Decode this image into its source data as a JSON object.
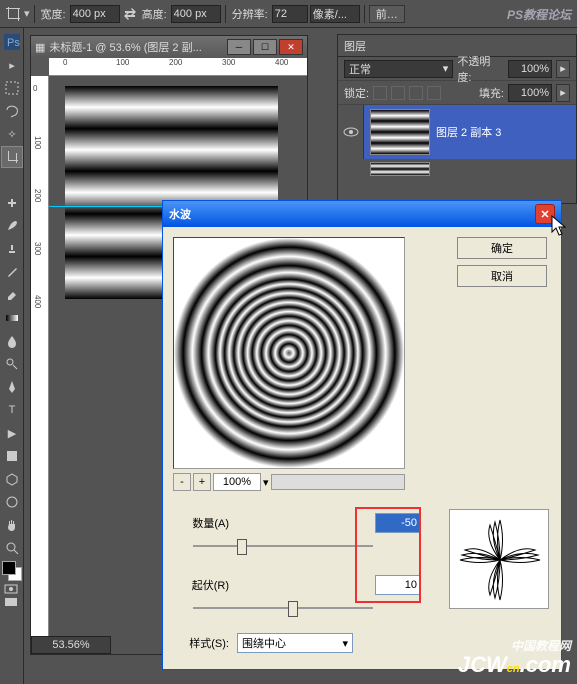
{
  "options": {
    "width_label": "宽度:",
    "width_value": "400 px",
    "height_label": "高度:",
    "height_value": "400 px",
    "res_label": "分辨率:",
    "res_value": "72",
    "units": "像素/...",
    "front_btn": "前…"
  },
  "document": {
    "title": "未标题-1 @ 53.6% (图层 2 副...",
    "zoom": "53.56%",
    "ruler_top": [
      "0",
      "100",
      "200",
      "300",
      "400"
    ],
    "ruler_left": [
      "0",
      "100",
      "200",
      "300",
      "400"
    ]
  },
  "layers": {
    "tab": "图层",
    "blend": "正常",
    "opacity_label": "不透明度:",
    "opacity": "100%",
    "lock_label": "锁定:",
    "fill_label": "填充:",
    "fill": "100%",
    "layer_name": "图层 2 副本 3"
  },
  "dialog": {
    "title": "水波",
    "ok": "确定",
    "cancel": "取消",
    "zoom": "100%",
    "amount_label": "数量(A)",
    "amount_value": "-50",
    "ridges_label": "起伏(R)",
    "ridges_value": "10",
    "style_label": "样式(S):",
    "style_value": "围绕中心"
  },
  "watermark": {
    "top": "PS教程论坛",
    "mid": "中国教程网",
    "site": "JCWcn.com"
  }
}
